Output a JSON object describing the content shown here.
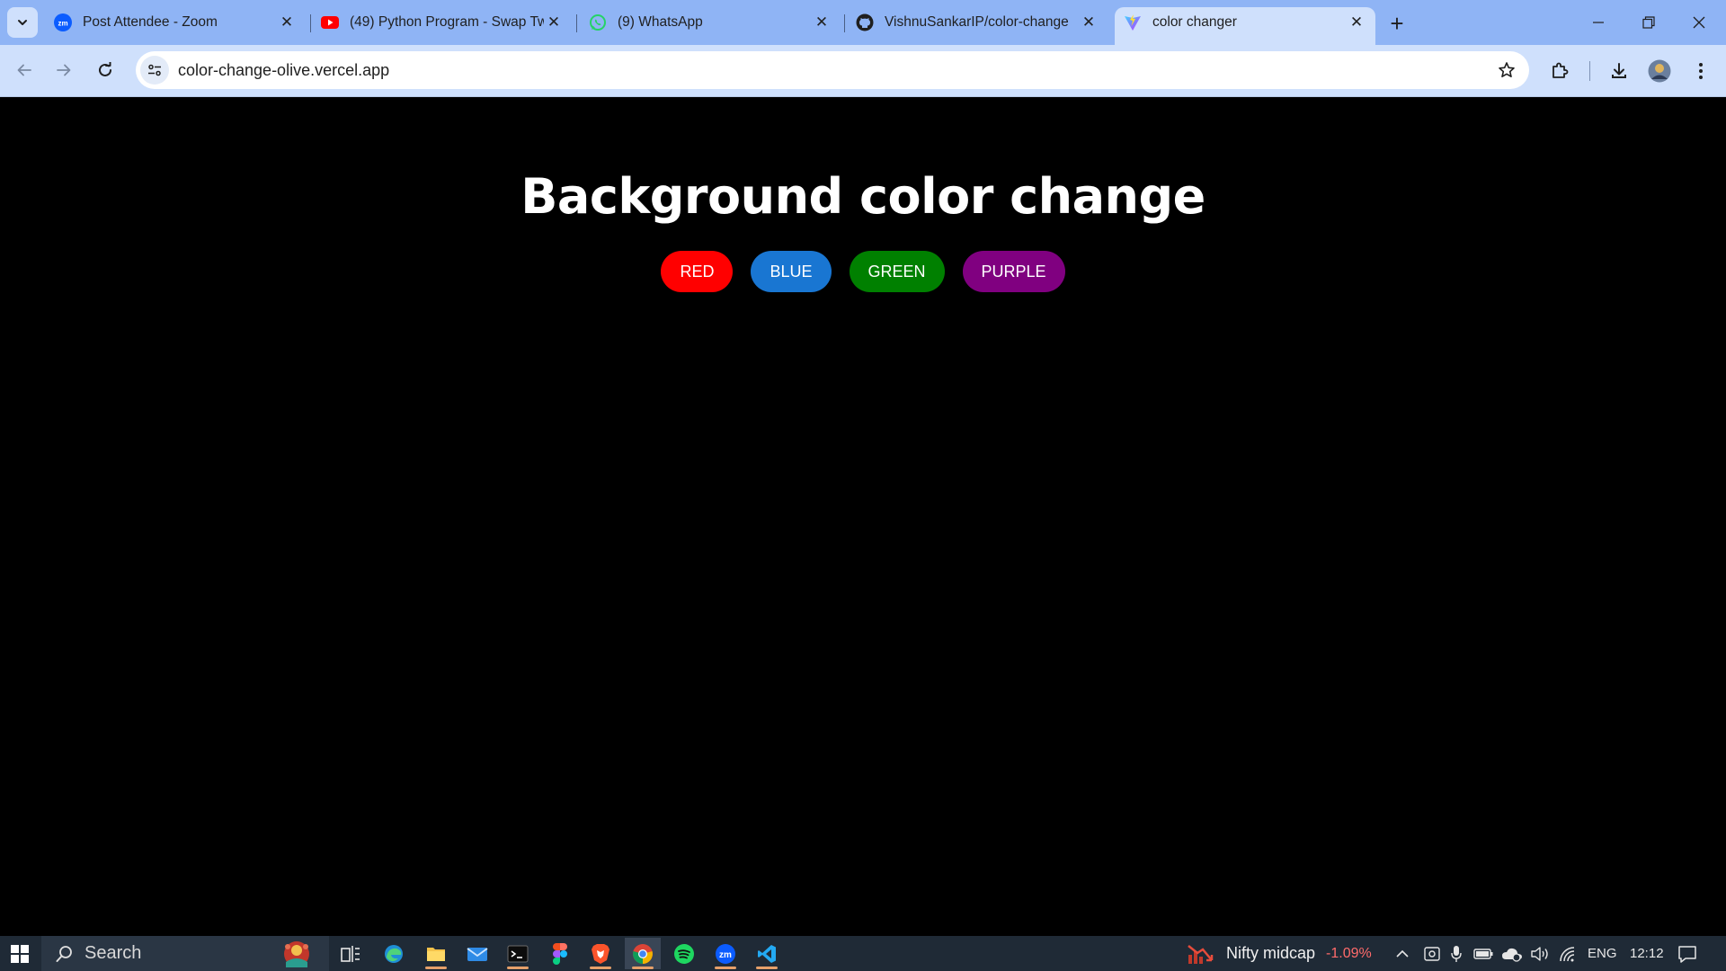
{
  "browser": {
    "tabs": [
      {
        "title": "Post Attendee - Zoom",
        "icon": "zoom-icon",
        "active": false
      },
      {
        "title": "(49) Python Program - Swap Tw",
        "icon": "youtube-icon",
        "active": false
      },
      {
        "title": "(9) WhatsApp",
        "icon": "whatsapp-icon",
        "active": false
      },
      {
        "title": "VishnuSankarIP/color-change",
        "icon": "github-icon",
        "active": false
      },
      {
        "title": "color changer",
        "icon": "vite-icon",
        "active": true
      }
    ],
    "url": "color-change-olive.vercel.app"
  },
  "page": {
    "heading": "Background color change",
    "buttons": [
      {
        "label": "RED",
        "color": "#ff0000"
      },
      {
        "label": "BLUE",
        "color": "#1976d2"
      },
      {
        "label": "GREEN",
        "color": "#008000"
      },
      {
        "label": "PURPLE",
        "color": "#800080"
      }
    ],
    "background": "#000000"
  },
  "taskbar": {
    "search_label": "Search",
    "stock_name": "Nifty midcap",
    "stock_change": "-1.09%",
    "language": "ENG",
    "time": "12:12"
  },
  "colors": {
    "tabstrip": "#8fb4f5",
    "toolbar": "#cfe0fc",
    "taskbar": "#1f2a36",
    "stock_negative": "#ff6b6b"
  }
}
